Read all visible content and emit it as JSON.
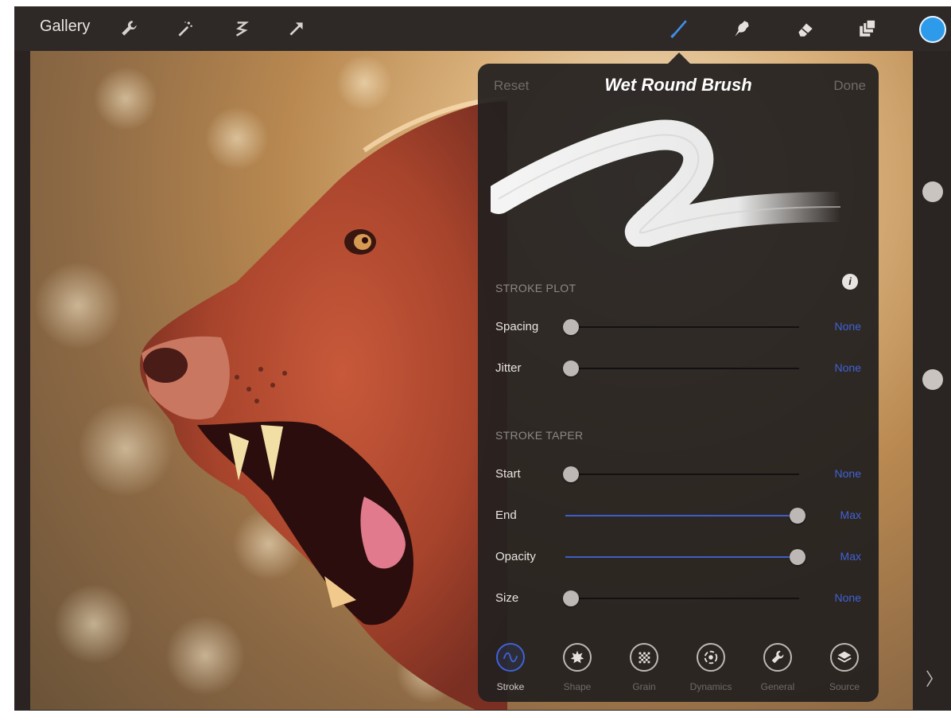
{
  "toolbar": {
    "gallery_label": "Gallery",
    "left_tools": [
      "wrench-icon",
      "magic-wand-icon",
      "selection-icon",
      "transform-arrow-icon"
    ],
    "right_tools": [
      "brush-icon",
      "smudge-icon",
      "eraser-icon",
      "layers-icon"
    ],
    "active_tool": "brush-icon",
    "color": "#2d9bea"
  },
  "panel": {
    "reset_label": "Reset",
    "title": "Wet Round Brush",
    "done_label": "Done",
    "stroke_plot": {
      "heading": "STROKE PLOT",
      "rows": [
        {
          "label": "Spacing",
          "value": "None",
          "level": 0
        },
        {
          "label": "Jitter",
          "value": "None",
          "level": 0
        }
      ]
    },
    "stroke_taper": {
      "heading": "STROKE TAPER",
      "rows": [
        {
          "label": "Start",
          "value": "None",
          "level": 0
        },
        {
          "label": "End",
          "value": "Max",
          "level": 1
        },
        {
          "label": "Opacity",
          "value": "Max",
          "level": 1
        },
        {
          "label": "Size",
          "value": "None",
          "level": 0
        }
      ]
    },
    "tabs": [
      {
        "label": "Stroke",
        "icon": "stroke-wave-icon",
        "active": true
      },
      {
        "label": "Shape",
        "icon": "shape-icon",
        "active": false
      },
      {
        "label": "Grain",
        "icon": "grain-icon",
        "active": false
      },
      {
        "label": "Dynamics",
        "icon": "dynamics-icon",
        "active": false
      },
      {
        "label": "General",
        "icon": "general-wrench-icon",
        "active": false
      },
      {
        "label": "Source",
        "icon": "source-layers-icon",
        "active": false
      }
    ],
    "accent_color": "#3f62d6"
  }
}
